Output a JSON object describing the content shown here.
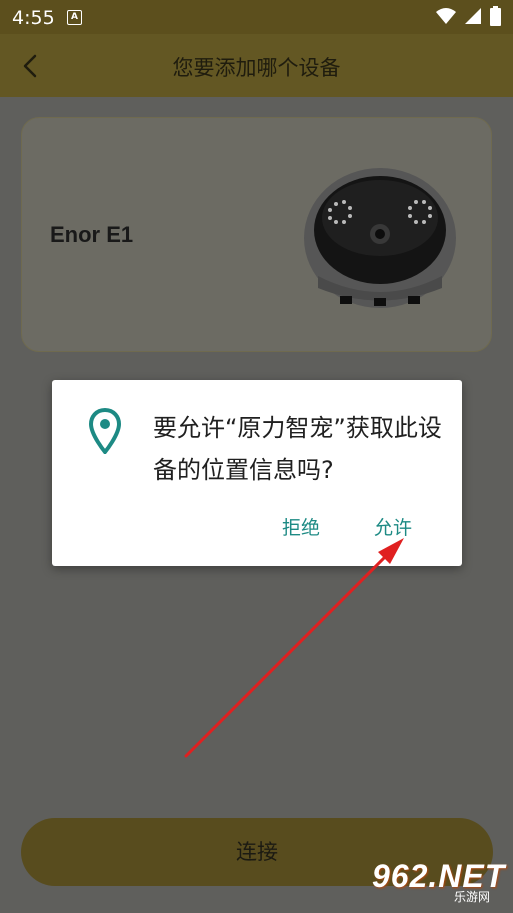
{
  "status_bar": {
    "time": "4:55",
    "icons": [
      "text-a-icon",
      "wifi-icon",
      "signal-icon",
      "battery-icon"
    ]
  },
  "app_bar": {
    "title": "您要添加哪个设备",
    "back_icon": "chevron-left-icon"
  },
  "device": {
    "name": "Enor E1",
    "image": "robot-camera-image"
  },
  "connect_button": {
    "label": "连接"
  },
  "permission_dialog": {
    "icon": "location-pin-icon",
    "message": "要允许“原力智宠”获取此设备的位置信息吗?",
    "deny_label": "拒绝",
    "allow_label": "允许"
  },
  "watermark": {
    "logo": "962.NET",
    "sub": "乐游网"
  },
  "colors": {
    "app_bar": "#635723",
    "button": "#584c1e",
    "dialog_action": "#1d8a84",
    "annotation_arrow": "#e02020"
  }
}
